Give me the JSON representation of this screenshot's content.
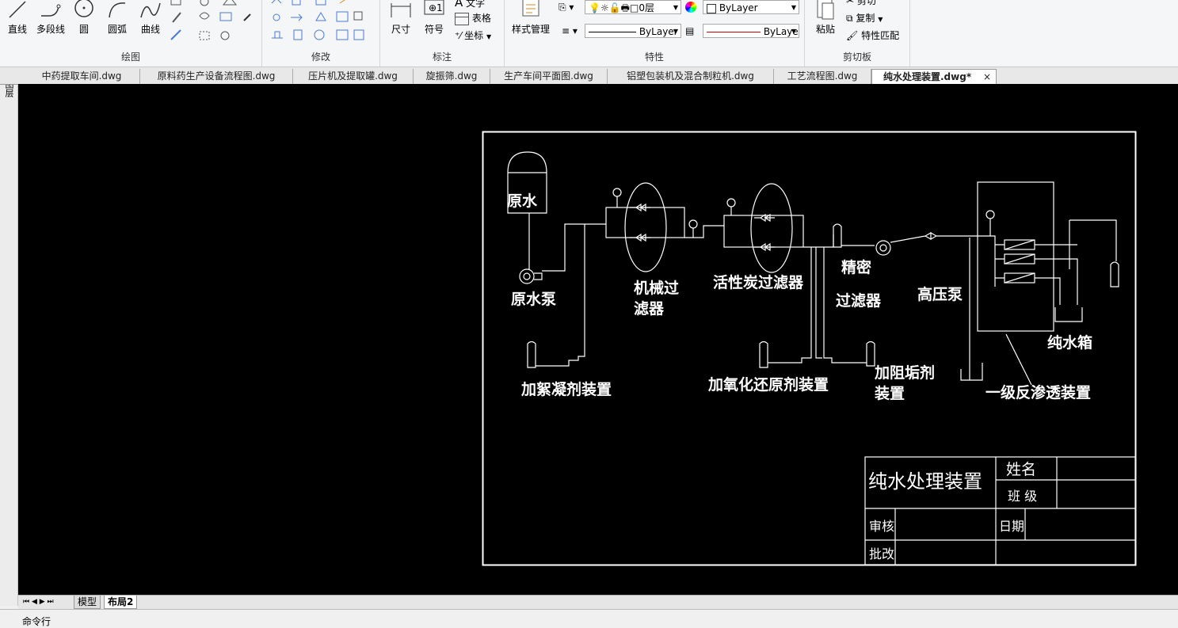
{
  "ribbon": {
    "draw_panel": {
      "title": "绘图",
      "buttons": [
        "直线",
        "多段线",
        "圆",
        "圆弧",
        "曲线"
      ]
    },
    "modify_panel": {
      "title": "修改"
    },
    "annotate_panel": {
      "title": "标注",
      "dimension": "尺寸",
      "symbol": "符号",
      "text": "文字",
      "table": "表格",
      "coordinate": "坐标"
    },
    "properties_panel": {
      "title": "特性",
      "style_manager": "样式管理",
      "layer_value": "0层",
      "color_value": "ByLayer",
      "linetype_value": "ByLayer",
      "lineweight_value": "ByLaye"
    },
    "clipboard_panel": {
      "title": "剪切板",
      "paste": "粘贴",
      "cut": "剪切",
      "copy": "复制",
      "match_properties": "特性匹配"
    }
  },
  "tabs": [
    {
      "label": "中药提取车间.dwg"
    },
    {
      "label": "原料药生产设备流程图.dwg"
    },
    {
      "label": "压片机及提取罐.dwg"
    },
    {
      "label": "旋振筛.dwg"
    },
    {
      "label": "生产车间平面图.dwg"
    },
    {
      "label": "铝塑包装机及混合制粒机.dwg"
    },
    {
      "label": "工艺流程图.dwg"
    },
    {
      "label": "纯水处理装置.dwg*",
      "active": true
    }
  ],
  "tab_close": "×",
  "left_strip_label": "图层",
  "drawing": {
    "labels": {
      "raw_water": "原水",
      "raw_water_pump": "原水泵",
      "mech_filter_1": "机械过",
      "mech_filter_2": "滤器",
      "carbon_filter": "活性炭过滤器",
      "precision_1": "精密",
      "precision_2": "过滤器",
      "high_pressure_pump": "高压泵",
      "pure_water_tank": "纯水箱",
      "flocculant": "加絮凝剂装置",
      "redox": "加氧化还原剂装置",
      "antiscalant_1": "加阻垢剂",
      "antiscalant_2": "装置",
      "ro": "一级反渗透装置"
    },
    "title_block": {
      "title": "纯水处理装置",
      "name": "姓名",
      "class": "班 级",
      "review": "审核",
      "date": "日期",
      "approve": "批改"
    }
  },
  "layout_tabs": {
    "model": "模型",
    "layout2": "布局2"
  },
  "command_line": "命令行"
}
